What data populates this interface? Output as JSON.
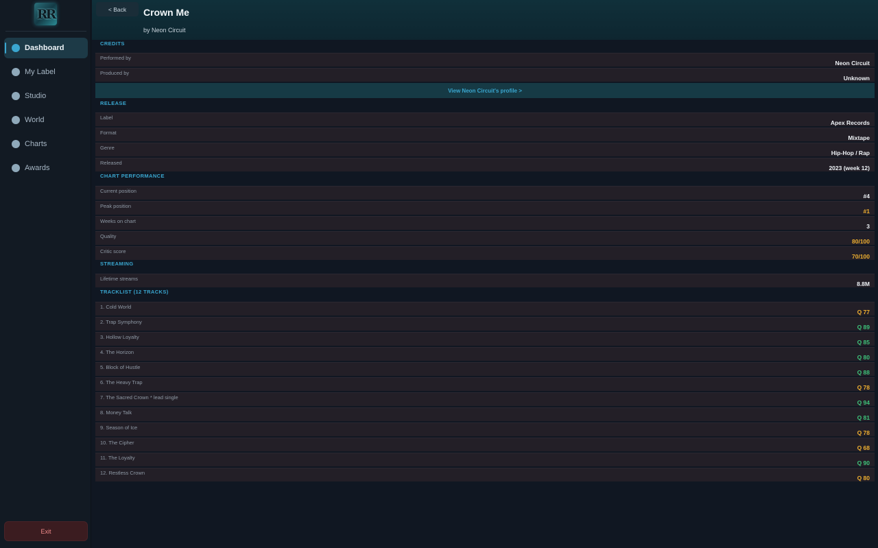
{
  "sidebar": {
    "logo_text": "RR",
    "items": [
      {
        "label": "Dashboard"
      },
      {
        "label": "My Label"
      },
      {
        "label": "Studio"
      },
      {
        "label": "World"
      },
      {
        "label": "Charts"
      },
      {
        "label": "Awards"
      }
    ],
    "exit_label": "Exit"
  },
  "header": {
    "back_label": "< Back",
    "title": "Crown Me",
    "subtitle": "by Neon Circuit"
  },
  "credits": {
    "heading": "CREDITS",
    "rows": [
      {
        "label": "Performed by",
        "value": "Neon Circuit"
      },
      {
        "label": "Produced by",
        "value": "Unknown"
      }
    ],
    "profile_link": "View Neon Circuit's profile  >"
  },
  "release": {
    "heading": "RELEASE",
    "rows": [
      {
        "label": "Label",
        "value": "Apex Records"
      },
      {
        "label": "Format",
        "value": "Mixtape"
      },
      {
        "label": "Genre",
        "value": "Hip-Hop / Rap"
      },
      {
        "label": "Released",
        "value": "2023  (week 12)"
      }
    ]
  },
  "chart_performance": {
    "heading": "CHART PERFORMANCE",
    "rows": [
      {
        "label": "Current position",
        "value": "#4"
      },
      {
        "label": "Peak position",
        "value": "#1"
      },
      {
        "label": "Weeks on chart",
        "value": "3"
      },
      {
        "label": "Quality",
        "value": "80/100"
      },
      {
        "label": "Critic score",
        "value": "70/100"
      }
    ]
  },
  "streaming": {
    "heading": "STREAMING",
    "rows": [
      {
        "label": "Lifetime streams",
        "value": "8.8M"
      }
    ]
  },
  "tracklist": {
    "heading": "TRACKLIST (12 TRACKS)",
    "tracks": [
      {
        "title": "1. Cold World",
        "quality": "Q 77"
      },
      {
        "title": "2. Trap Symphony",
        "quality": "Q 89"
      },
      {
        "title": "3. Hollow Loyalty",
        "quality": "Q 85"
      },
      {
        "title": "4. The Horizon",
        "quality": "Q 80"
      },
      {
        "title": "5. Block of Hustle",
        "quality": "Q 88"
      },
      {
        "title": "6. The Heavy Trap",
        "quality": "Q 78"
      },
      {
        "title": "7. The Sacred Crown  * lead single",
        "quality": "Q 94"
      },
      {
        "title": "8. Money Talk",
        "quality": "Q 81"
      },
      {
        "title": "9. Season of Ice",
        "quality": "Q 78"
      },
      {
        "title": "10. The Cipher",
        "quality": "Q 68"
      },
      {
        "title": "11. The Loyalty",
        "quality": "Q 90"
      },
      {
        "title": "12. Restless Crown",
        "quality": "Q 80"
      }
    ]
  },
  "colors": {
    "accent": "#3aa6cf",
    "gold": "#f0b030",
    "green": "#3ec47a",
    "exit": "#f08a8a"
  }
}
